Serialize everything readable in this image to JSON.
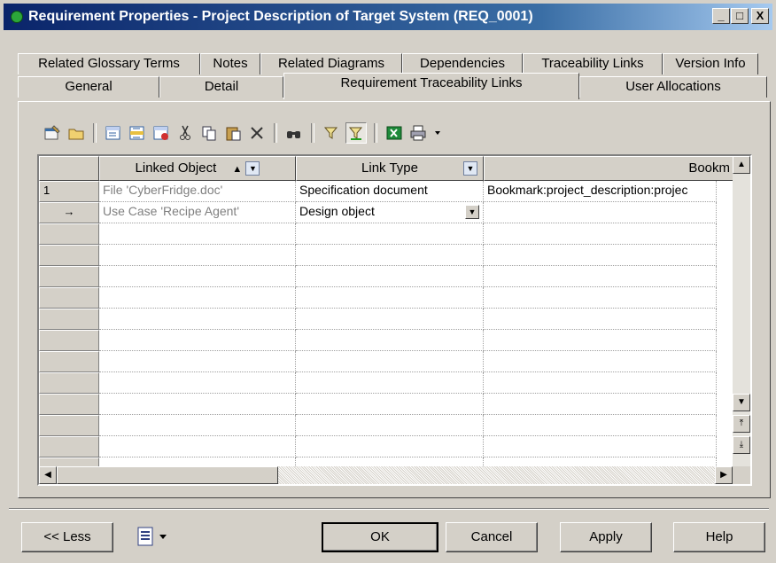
{
  "window": {
    "title": "Requirement Properties - Project Description of Target System (REQ_0001)",
    "controls": [
      "_",
      "□",
      "X"
    ]
  },
  "tabs": {
    "row1": [
      "Related Glossary Terms",
      "Notes",
      "Related Diagrams",
      "Dependencies",
      "Traceability Links",
      "Version Info"
    ],
    "row2": [
      "General",
      "Detail",
      "Requirement Traceability Links",
      "User Allocations"
    ],
    "active": "Requirement Traceability Links"
  },
  "toolbar": {
    "icons": [
      "properties-icon",
      "open-folder-icon",
      "add-row-icon",
      "insert-row-icon",
      "add-objects-icon",
      "cut-icon",
      "copy-icon",
      "paste-icon",
      "delete-icon",
      "find-icon",
      "filter-icon",
      "filter-active-icon",
      "excel-export-icon",
      "print-icon",
      "dropdown-icon"
    ]
  },
  "grid": {
    "columns": [
      "Linked Object",
      "Link Type",
      "Bookm"
    ],
    "rows": [
      {
        "marker": "1",
        "linked_object": "File 'CyberFridge.doc'",
        "link_type": "Specification document",
        "bookmark": "Bookmark:project_description:projec"
      },
      {
        "marker": "→",
        "linked_object": "Use Case 'Recipe Agent'",
        "link_type": "Design object",
        "bookmark": ""
      }
    ],
    "empty_rows": 12
  },
  "buttons": {
    "less": "<< Less",
    "ok": "OK",
    "cancel": "Cancel",
    "apply": "Apply",
    "help": "Help"
  },
  "colors": {
    "title_start": "#0a246a",
    "title_end": "#a6caf0",
    "face": "#d4d0c8"
  }
}
